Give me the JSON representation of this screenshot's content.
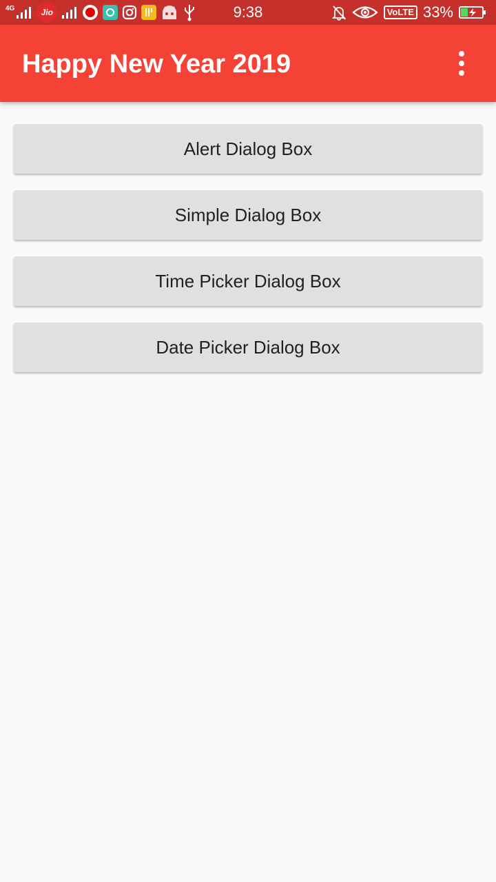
{
  "status_bar": {
    "network_type": "4G",
    "carrier_badge": "Jio",
    "time": "9:38",
    "volte_label": "VoLTE",
    "battery_percent": "33%",
    "icons": [
      "signal-icon",
      "jio-icon",
      "signal-icon",
      "vodafone-icon",
      "chat-app-icon",
      "instagram-icon",
      "food-app-icon",
      "android-icon",
      "usb-icon",
      "bell-off-icon",
      "eye-icon",
      "volte-icon",
      "battery-charging-icon"
    ]
  },
  "app_bar": {
    "title": "Happy New Year 2019",
    "menu_icon": "more-vert-icon"
  },
  "buttons": [
    {
      "label": "Alert Dialog Box"
    },
    {
      "label": "Simple Dialog Box"
    },
    {
      "label": "Time Picker Dialog Box"
    },
    {
      "label": "Date Picker Dialog Box"
    }
  ],
  "colors": {
    "status_bar": "#c5302a",
    "app_bar": "#f44336",
    "button_bg": "#e0e0e0",
    "background": "#fafafa"
  }
}
